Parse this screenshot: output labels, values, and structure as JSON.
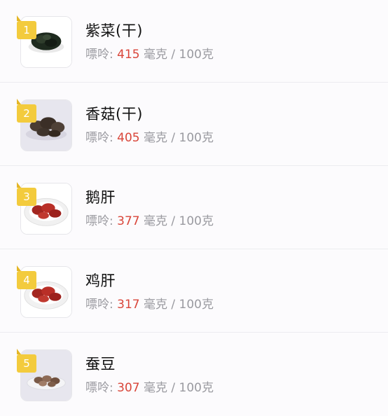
{
  "items": [
    {
      "rank": "1",
      "name": "紫菜(干)",
      "label": "嘌呤:",
      "value": "415",
      "unit": "毫克 / 100克",
      "icon": "seaweed-image"
    },
    {
      "rank": "2",
      "name": "香菇(干)",
      "label": "嘌呤:",
      "value": "405",
      "unit": "毫克 / 100克",
      "icon": "mushroom-image"
    },
    {
      "rank": "3",
      "name": "鹅肝",
      "label": "嘌呤:",
      "value": "377",
      "unit": "毫克 / 100克",
      "icon": "liver-plate-image"
    },
    {
      "rank": "4",
      "name": "鸡肝",
      "label": "嘌呤:",
      "value": "317",
      "unit": "毫克 / 100克",
      "icon": "liver-plate-image"
    },
    {
      "rank": "5",
      "name": "蚕豆",
      "label": "嘌呤:",
      "value": "307",
      "unit": "毫克 / 100克",
      "icon": "broad-bean-image"
    }
  ],
  "colors": {
    "badge": "#f3cb3d",
    "value": "#d9463a",
    "muted": "#9a9aa0"
  }
}
